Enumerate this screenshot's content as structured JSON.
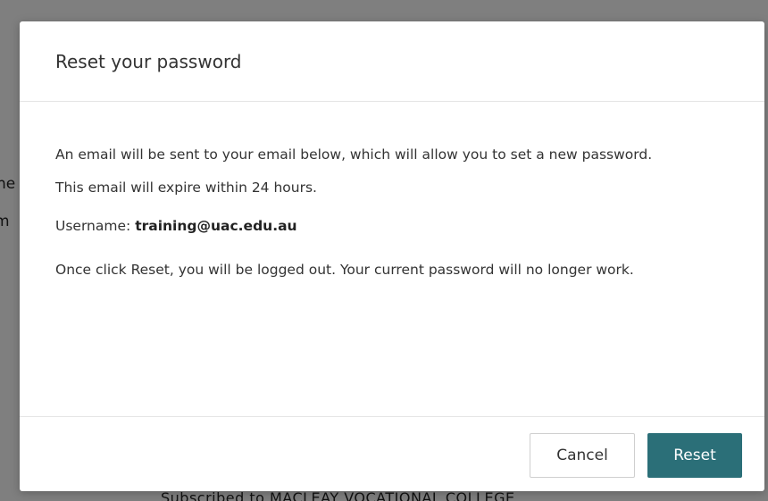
{
  "background": {
    "fragment_1": "ne",
    "fragment_2": "m",
    "fragment_3": "Subscribed to MACLEAY VOCATIONAL COLLEGE"
  },
  "modal": {
    "title": "Reset your password",
    "body": {
      "line_1": "An email will be sent to your email below, which will allow you to set a new password.",
      "line_2": "This email will expire within 24 hours.",
      "username_label": "Username:",
      "username_value": "training@uac.edu.au",
      "warning": "Once click Reset, you will be logged out. Your current password will no longer work."
    },
    "buttons": {
      "cancel": "Cancel",
      "reset": "Reset"
    }
  },
  "colors": {
    "primary_button": "#2b6f78",
    "overlay": "rgba(0,0,0,0.5)"
  }
}
